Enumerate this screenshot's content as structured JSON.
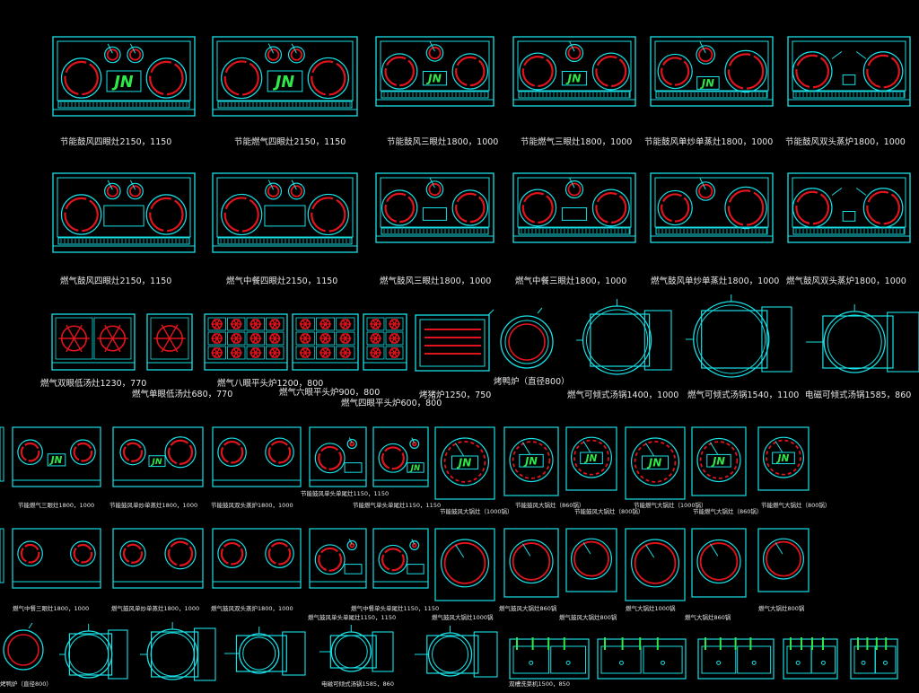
{
  "colors": {
    "background": "#000000",
    "outline": "#19e0e6",
    "burner": "#e0141c",
    "logo": "#2ee84a",
    "label": "#e8e8e8"
  },
  "logo_text": "JN",
  "labels": {
    "r1": [
      "节能鼓风四眼灶2150，1150",
      "节能燃气四眼灶2150，1150",
      "节能鼓风三眼灶1800，1000",
      "节能燃气三眼灶1800，1000",
      "节能鼓风单炒单蒸灶1800，1000",
      "节能鼓风双头蒸炉1800，1000"
    ],
    "r2": [
      "燃气鼓风四眼灶2150，1150",
      "燃气中餐四眼灶2150，1150",
      "燃气鼓风三眼灶1800，1000",
      "燃气中餐三眼灶1800，1000",
      "燃气鼓风单炒单蒸灶1800，1000",
      "燃气鼓风双头蒸炉1800，1000"
    ],
    "r3": [
      "燃气双眼低汤灶1230，770",
      "燃气单眼低汤灶680，770",
      "燃气八眼平头炉1200，800",
      "燃气六眼平头炉900，800",
      "燃气四眼平头炉600，800",
      "烤猪炉1250，750",
      "烤鸭炉（直径800）",
      "燃气可倾式汤锅1400，1000",
      "燃气可倾式汤锅1540，1100",
      "电磁可倾式汤锅1585，860"
    ],
    "r4": [
      "节能燃气三眼灶1800，1000",
      "节能鼓风单炒单蒸灶1800，1000",
      "节能鼓风双头蒸炉1800，1000",
      "节能鼓风单头单尾灶1150，1150",
      "节能燃气单头单尾灶1150，1150",
      "节能鼓风大锅灶（1000锅）",
      "节能鼓风大锅灶（860锅）",
      "节能鼓风大锅灶（800锅）",
      "节能燃气大锅灶（1000锅）",
      "节能燃气大锅灶（860锅）",
      "节能燃气大锅灶（800锅）"
    ],
    "r5": [
      "燃气中餐三眼灶1800，1000",
      "燃气鼓风单炒单蒸灶1800，1000",
      "燃气鼓风双头蒸炉1800，1000",
      "燃气中餐单头单尾灶1150，1150",
      "燃气鼓风单头单尾灶1150，1150",
      "燃气鼓风大锅灶1000锅",
      "燃气鼓风大锅灶860锅",
      "燃气鼓风大锅灶800锅",
      "燃气大锅灶1000锅",
      "燃气大锅灶860锅",
      "燃气大锅灶800锅"
    ],
    "r6": [
      "烤鸭炉（直径800）",
      "电磁可倾式汤锅1585，860",
      "双槽洗菜机1500，850"
    ]
  }
}
